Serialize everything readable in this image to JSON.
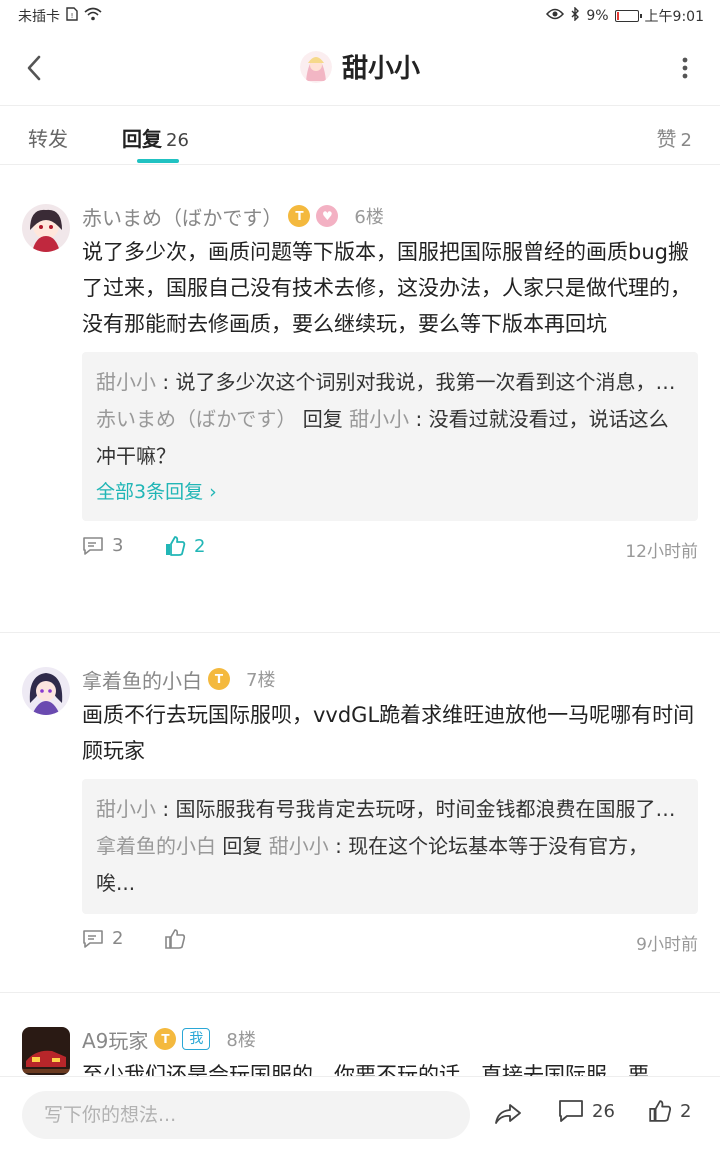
{
  "status_bar": {
    "carrier": "未插卡",
    "battery": "9%",
    "battery_level": 0.09,
    "time": "上午9:01"
  },
  "header": {
    "title": "甜小小"
  },
  "tabs": {
    "repost": "转发",
    "reply": "回复",
    "reply_count": "26",
    "like": "赞",
    "like_count": "2"
  },
  "comments": [
    {
      "user": "赤いまめ（ばかです）",
      "floor": "6楼",
      "content": "说了多少次，画质问题等下版本，国服把国际服曾经的画质bug搬了过来，国服自己没有技术去修，这没办法，人家只是做代理的，没有那能耐去修画质，要么继续玩，要么等下版本再回坑",
      "replies": [
        {
          "name": "甜小小",
          "text": "说了多少次这个词别对我说，我第一次看到这个消息，报bug没地方，官群也没有，官贴也没发，你说我是看..."
        },
        {
          "name": "赤いまめ（ばかです）",
          "reply_word": "回复",
          "target": "甜小小",
          "text": "没看过就没看过，说话这么冲干嘛？"
        }
      ],
      "see_all": "全部3条回复 ›",
      "comment_count": "3",
      "like_count": "2",
      "time": "12小时前"
    },
    {
      "user": "拿着鱼的小白",
      "floor": "7楼",
      "content": "画质不行去玩国际服呗，vvdGL跪着求维旺迪放他一马呢哪有时间顾玩家",
      "replies": [
        {
          "name": "甜小小",
          "text": "国际服我有号我肯定去玩呀，时间金钱都浪费在国服了，而且我发这种贴，肯定不会有好心情的，你发了句:..."
        },
        {
          "name": "拿着鱼的小白",
          "reply_word": "回复",
          "target": "甜小小",
          "text": "现在这个论坛基本等于没有官方，唉..."
        }
      ],
      "comment_count": "2",
      "time": "9小时前"
    },
    {
      "user": "A9玩家",
      "me_tag": "我",
      "floor": "8楼",
      "content": "至少我们还是会玩国服的，你要不玩的话，直接去国际服，要"
    }
  ],
  "bottom_bar": {
    "input_placeholder": "写下你的想法...",
    "comment_count": "26",
    "like_count": "2"
  },
  "colors": {
    "accent": "#21c2c2",
    "badge_gold": "#f4b93e",
    "me_tag": "#2aa7d6"
  }
}
